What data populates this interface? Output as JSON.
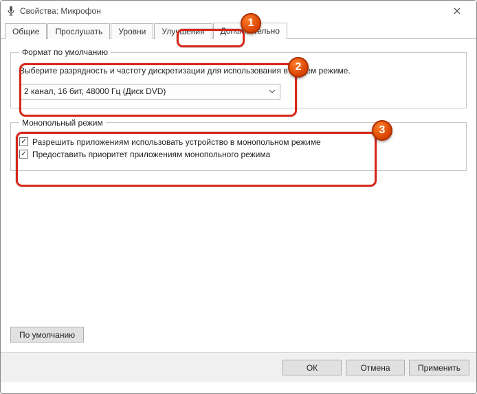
{
  "window": {
    "title": "Свойства: Микрофон"
  },
  "tabs": {
    "general": "Общие",
    "listen": "Прослушать",
    "levels": "Уровни",
    "enhancements": "Улучшения",
    "advanced": "Дополнительно"
  },
  "default_format": {
    "legend": "Формат по умолчанию",
    "description": "Выберите разрядность и частоту дискретизации для использования в общем режиме.",
    "selected": "2 канал, 16 бит, 48000 Гц (Диск DVD)"
  },
  "exclusive": {
    "legend": "Монопольный режим",
    "allow_exclusive": "Разрешить приложениям использовать устройство в монопольном режиме",
    "give_priority": "Предоставить приоритет приложениям монопольного режима"
  },
  "buttons": {
    "restore_defaults": "По умолчанию",
    "ok": "ОК",
    "cancel": "Отмена",
    "apply": "Применить"
  },
  "annotations": {
    "b1": "1",
    "b2": "2",
    "b3": "3"
  }
}
